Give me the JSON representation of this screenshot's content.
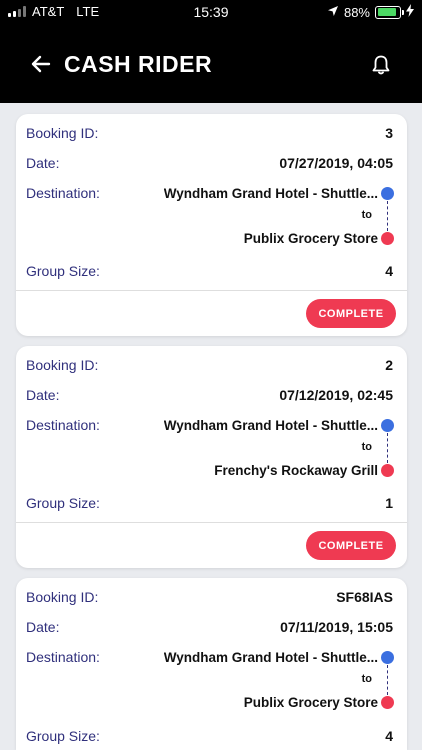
{
  "status_bar": {
    "carrier": "AT&T",
    "network": "LTE",
    "time": "15:39",
    "battery_percent": "88%",
    "battery_level": 0.88,
    "battery_color": "#4cd964",
    "icons": [
      "signal-bars-icon",
      "location-arrow-icon",
      "battery-icon",
      "charging-bolt-icon"
    ]
  },
  "header": {
    "title": "CASH RIDER",
    "back_icon": "arrow-left-icon",
    "notification_icon": "bell-icon"
  },
  "labels": {
    "booking_id": "Booking ID:",
    "date": "Date:",
    "destination": "Destination:",
    "group_size": "Group Size:",
    "to": "to",
    "complete": "COMPLETE"
  },
  "colors": {
    "accent_red": "#ef3a52",
    "origin_blue": "#3b6fe0",
    "label_navy": "#30307c"
  },
  "bookings": [
    {
      "booking_id": "3",
      "date": "07/27/2019, 04:05",
      "origin": "Wyndham Grand Hotel - Shuttle...",
      "destination": "Publix Grocery Store",
      "group_size": "4"
    },
    {
      "booking_id": "2",
      "date": "07/12/2019, 02:45",
      "origin": "Wyndham Grand Hotel - Shuttle...",
      "destination": "Frenchy's Rockaway Grill",
      "group_size": "1"
    },
    {
      "booking_id": "SF68IAS",
      "date": "07/11/2019, 15:05",
      "origin": "Wyndham Grand Hotel - Shuttle...",
      "destination": "Publix Grocery Store",
      "group_size": "4"
    }
  ]
}
